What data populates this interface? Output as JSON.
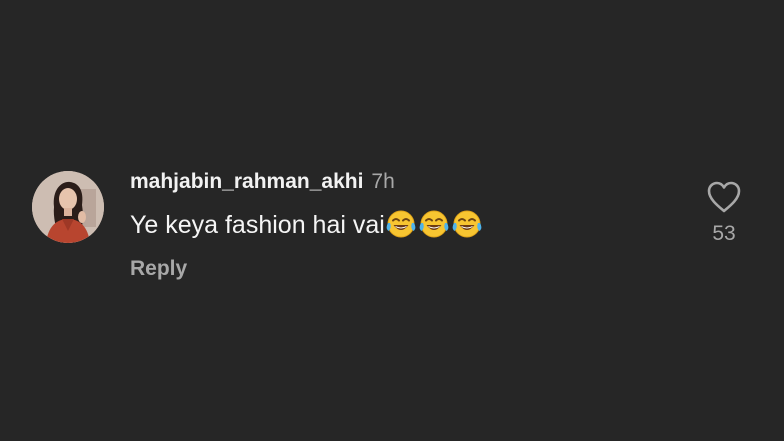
{
  "comment": {
    "username": "mahjabin_rahman_akhi",
    "time_ago": "7h",
    "text": "Ye keya fashion hai vai",
    "emoji_icons": [
      "face-with-tears-of-joy-icon",
      "face-with-tears-of-joy-icon",
      "face-with-tears-of-joy-icon"
    ],
    "reply_label": "Reply",
    "like_count": "53",
    "like_icon": "heart-outline-icon"
  },
  "colors": {
    "background": "#262626",
    "primary_text": "#f5f5f5",
    "secondary_text": "#a8a8a8"
  }
}
